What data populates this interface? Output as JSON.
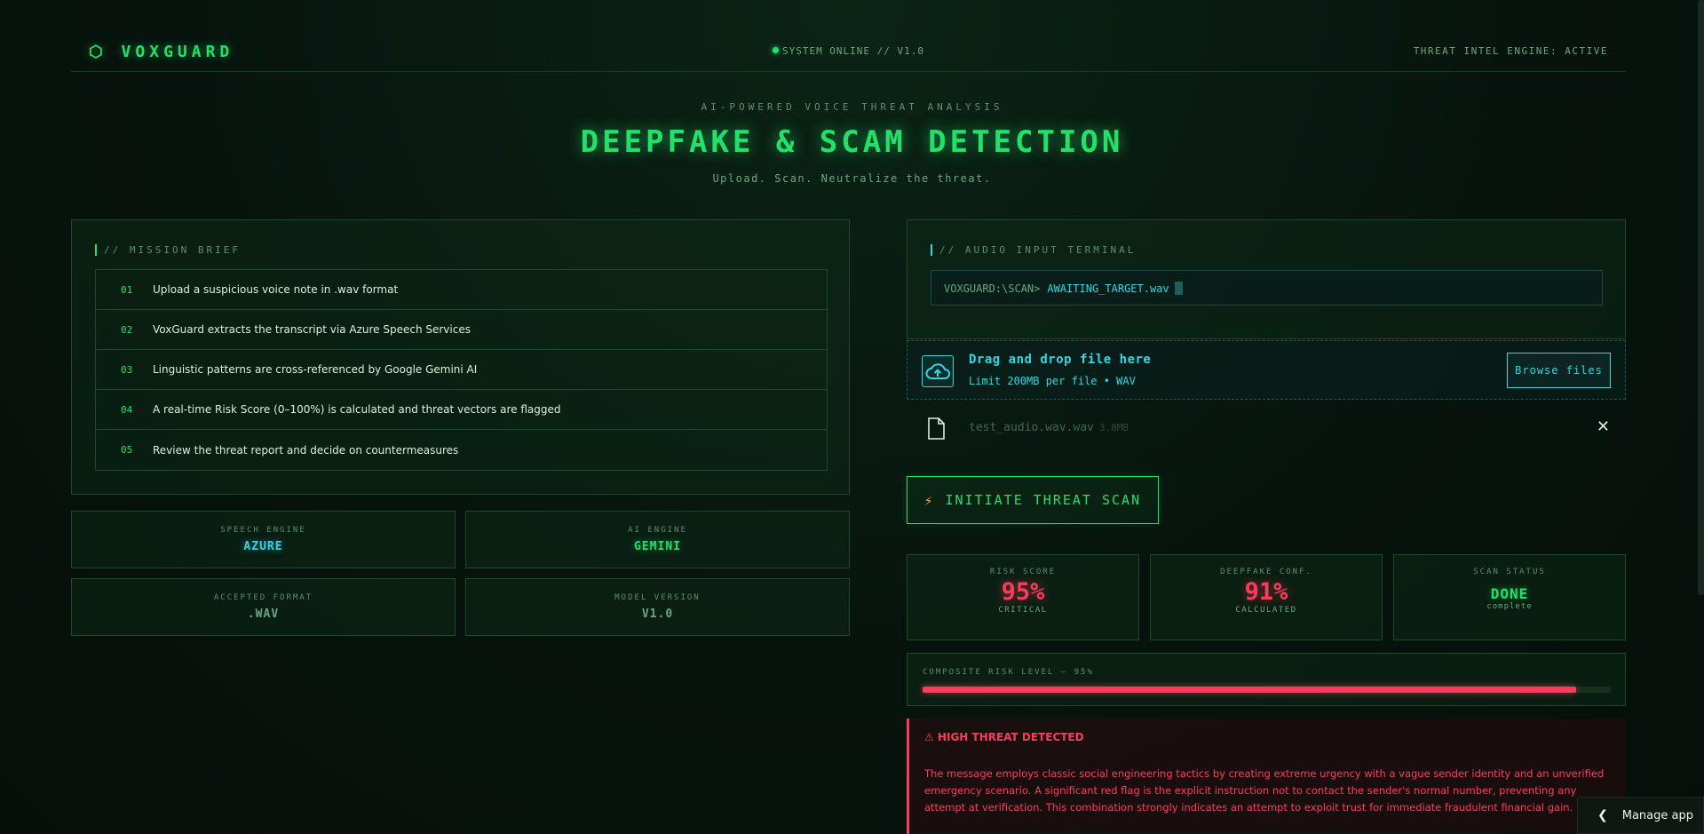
{
  "header": {
    "logo": "⬡ VOXGUARD",
    "status": "SYSTEM ONLINE // V1.0",
    "intel": "THREAT INTEL ENGINE: ACTIVE"
  },
  "hero": {
    "subtitle": "AI-POWERED VOICE THREAT ANALYSIS",
    "title": "DEEPFAKE & SCAM DETECTION",
    "tagline": "Upload. Scan. Neutralize the threat."
  },
  "mission": {
    "title": "// MISSION BRIEF",
    "steps": [
      {
        "num": "01",
        "text": "Upload a suspicious voice note in .wav format"
      },
      {
        "num": "02",
        "text": "VoxGuard extracts the transcript via Azure Speech Services"
      },
      {
        "num": "03",
        "text": "Linguistic patterns are cross-referenced by Google Gemini AI"
      },
      {
        "num": "04",
        "text": "A real-time Risk Score (0–100%) is calculated and threat vectors are flagged"
      },
      {
        "num": "05",
        "text": "Review the threat report and decide on countermeasures"
      }
    ]
  },
  "specs": {
    "speech_label": "SPEECH ENGINE",
    "speech_value": "AZURE",
    "ai_label": "AI ENGINE",
    "ai_value": "GEMINI",
    "format_label": "ACCEPTED FORMAT",
    "format_value": ".WAV",
    "model_label": "MODEL VERSION",
    "model_value": "V1.0"
  },
  "terminal": {
    "title": "// AUDIO INPUT TERMINAL",
    "prompt": "VOXGUARD:\\SCAN>",
    "target": "AWAITING_TARGET.wav"
  },
  "uploader": {
    "main": "Drag and drop file here",
    "sub": "Limit 200MB per file • WAV",
    "browse": "Browse files",
    "file_name": "test_audio.wav.wav",
    "file_size": "3.8MB"
  },
  "scan_button": "INITIATE THREAT SCAN",
  "metrics": {
    "risk_label": "RISK SCORE",
    "risk_value": "95%",
    "risk_sub": "CRITICAL",
    "deepfake_label": "DEEPFAKE CONF.",
    "deepfake_value": "91%",
    "deepfake_sub": "CALCULATED",
    "status_label": "SCAN STATUS",
    "status_value": "DONE",
    "status_sub": "complete"
  },
  "composite": {
    "label": "COMPOSITE RISK LEVEL — 95%",
    "level": 0.95
  },
  "threat": {
    "heading": "⚠ HIGH THREAT DETECTED",
    "body": "The message employs classic social engineering tactics by creating extreme urgency with a vague sender identity and an unverified emergency scenario. A significant red flag is the explicit instruction not to contact the sender's normal number, preventing any attempt at verification. This combination strongly indicates an attempt to exploit trust for immediate fraudulent financial gain."
  },
  "manage_app": "Manage app",
  "colors": {
    "accent": "#22e06a",
    "cyan": "#2fd6e6",
    "danger": "#ff3b5c",
    "background": "#07140d"
  }
}
